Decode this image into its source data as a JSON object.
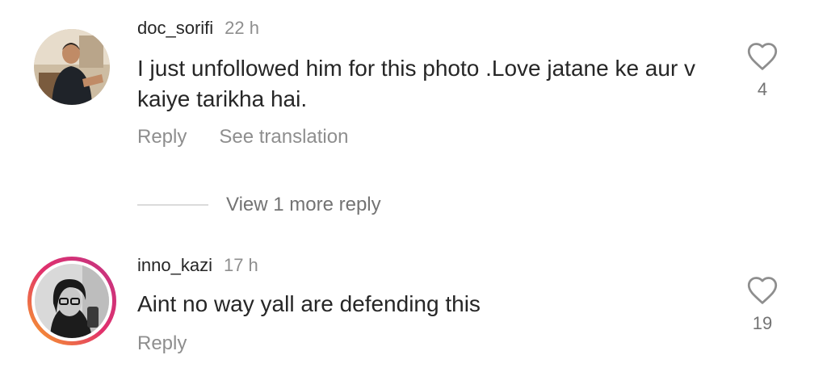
{
  "comments": [
    {
      "username": "doc_sorifi",
      "time": "22 h",
      "text": "I just unfollowed him for this photo .Love  jatane ke aur v kaiye tarikha hai.",
      "actions": {
        "reply": "Reply",
        "translate": "See translation"
      },
      "likes": "4",
      "icons": {
        "like": "heart-outline-icon"
      }
    },
    {
      "username": "inno_kazi",
      "time": "17 h",
      "text": "Aint no way yall are defending this",
      "actions": {
        "reply": "Reply"
      },
      "likes": "19",
      "has_story_ring": true,
      "icons": {
        "like": "heart-outline-icon"
      }
    }
  ],
  "view_more": {
    "label": "View 1 more reply"
  },
  "colors": {
    "text_primary": "#262626",
    "text_secondary": "#8e8e8e",
    "story_ring_start": "#f9a825",
    "story_ring_end": "#d6249f"
  }
}
